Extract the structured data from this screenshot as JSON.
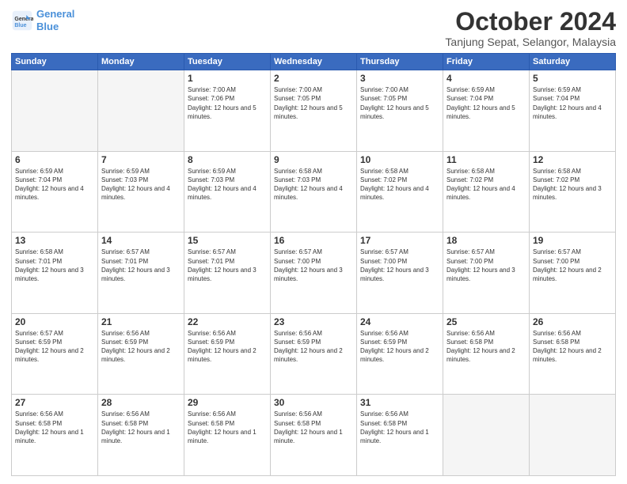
{
  "header": {
    "logo_line1": "General",
    "logo_line2": "Blue",
    "main_title": "October 2024",
    "subtitle": "Tanjung Sepat, Selangor, Malaysia"
  },
  "days_of_week": [
    "Sunday",
    "Monday",
    "Tuesday",
    "Wednesday",
    "Thursday",
    "Friday",
    "Saturday"
  ],
  "weeks": [
    [
      {
        "day": "",
        "empty": true
      },
      {
        "day": "",
        "empty": true
      },
      {
        "day": "1",
        "sunrise": "7:00 AM",
        "sunset": "7:06 PM",
        "daylight": "12 hours and 5 minutes."
      },
      {
        "day": "2",
        "sunrise": "7:00 AM",
        "sunset": "7:05 PM",
        "daylight": "12 hours and 5 minutes."
      },
      {
        "day": "3",
        "sunrise": "7:00 AM",
        "sunset": "7:05 PM",
        "daylight": "12 hours and 5 minutes."
      },
      {
        "day": "4",
        "sunrise": "6:59 AM",
        "sunset": "7:04 PM",
        "daylight": "12 hours and 5 minutes."
      },
      {
        "day": "5",
        "sunrise": "6:59 AM",
        "sunset": "7:04 PM",
        "daylight": "12 hours and 4 minutes."
      }
    ],
    [
      {
        "day": "6",
        "sunrise": "6:59 AM",
        "sunset": "7:04 PM",
        "daylight": "12 hours and 4 minutes."
      },
      {
        "day": "7",
        "sunrise": "6:59 AM",
        "sunset": "7:03 PM",
        "daylight": "12 hours and 4 minutes."
      },
      {
        "day": "8",
        "sunrise": "6:59 AM",
        "sunset": "7:03 PM",
        "daylight": "12 hours and 4 minutes."
      },
      {
        "day": "9",
        "sunrise": "6:58 AM",
        "sunset": "7:03 PM",
        "daylight": "12 hours and 4 minutes."
      },
      {
        "day": "10",
        "sunrise": "6:58 AM",
        "sunset": "7:02 PM",
        "daylight": "12 hours and 4 minutes."
      },
      {
        "day": "11",
        "sunrise": "6:58 AM",
        "sunset": "7:02 PM",
        "daylight": "12 hours and 4 minutes."
      },
      {
        "day": "12",
        "sunrise": "6:58 AM",
        "sunset": "7:02 PM",
        "daylight": "12 hours and 3 minutes."
      }
    ],
    [
      {
        "day": "13",
        "sunrise": "6:58 AM",
        "sunset": "7:01 PM",
        "daylight": "12 hours and 3 minutes."
      },
      {
        "day": "14",
        "sunrise": "6:57 AM",
        "sunset": "7:01 PM",
        "daylight": "12 hours and 3 minutes."
      },
      {
        "day": "15",
        "sunrise": "6:57 AM",
        "sunset": "7:01 PM",
        "daylight": "12 hours and 3 minutes."
      },
      {
        "day": "16",
        "sunrise": "6:57 AM",
        "sunset": "7:00 PM",
        "daylight": "12 hours and 3 minutes."
      },
      {
        "day": "17",
        "sunrise": "6:57 AM",
        "sunset": "7:00 PM",
        "daylight": "12 hours and 3 minutes."
      },
      {
        "day": "18",
        "sunrise": "6:57 AM",
        "sunset": "7:00 PM",
        "daylight": "12 hours and 3 minutes."
      },
      {
        "day": "19",
        "sunrise": "6:57 AM",
        "sunset": "7:00 PM",
        "daylight": "12 hours and 2 minutes."
      }
    ],
    [
      {
        "day": "20",
        "sunrise": "6:57 AM",
        "sunset": "6:59 PM",
        "daylight": "12 hours and 2 minutes."
      },
      {
        "day": "21",
        "sunrise": "6:56 AM",
        "sunset": "6:59 PM",
        "daylight": "12 hours and 2 minutes."
      },
      {
        "day": "22",
        "sunrise": "6:56 AM",
        "sunset": "6:59 PM",
        "daylight": "12 hours and 2 minutes."
      },
      {
        "day": "23",
        "sunrise": "6:56 AM",
        "sunset": "6:59 PM",
        "daylight": "12 hours and 2 minutes."
      },
      {
        "day": "24",
        "sunrise": "6:56 AM",
        "sunset": "6:59 PM",
        "daylight": "12 hours and 2 minutes."
      },
      {
        "day": "25",
        "sunrise": "6:56 AM",
        "sunset": "6:58 PM",
        "daylight": "12 hours and 2 minutes."
      },
      {
        "day": "26",
        "sunrise": "6:56 AM",
        "sunset": "6:58 PM",
        "daylight": "12 hours and 2 minutes."
      }
    ],
    [
      {
        "day": "27",
        "sunrise": "6:56 AM",
        "sunset": "6:58 PM",
        "daylight": "12 hours and 1 minute."
      },
      {
        "day": "28",
        "sunrise": "6:56 AM",
        "sunset": "6:58 PM",
        "daylight": "12 hours and 1 minute."
      },
      {
        "day": "29",
        "sunrise": "6:56 AM",
        "sunset": "6:58 PM",
        "daylight": "12 hours and 1 minute."
      },
      {
        "day": "30",
        "sunrise": "6:56 AM",
        "sunset": "6:58 PM",
        "daylight": "12 hours and 1 minute."
      },
      {
        "day": "31",
        "sunrise": "6:56 AM",
        "sunset": "6:58 PM",
        "daylight": "12 hours and 1 minute."
      },
      {
        "day": "",
        "empty": true
      },
      {
        "day": "",
        "empty": true
      }
    ]
  ]
}
